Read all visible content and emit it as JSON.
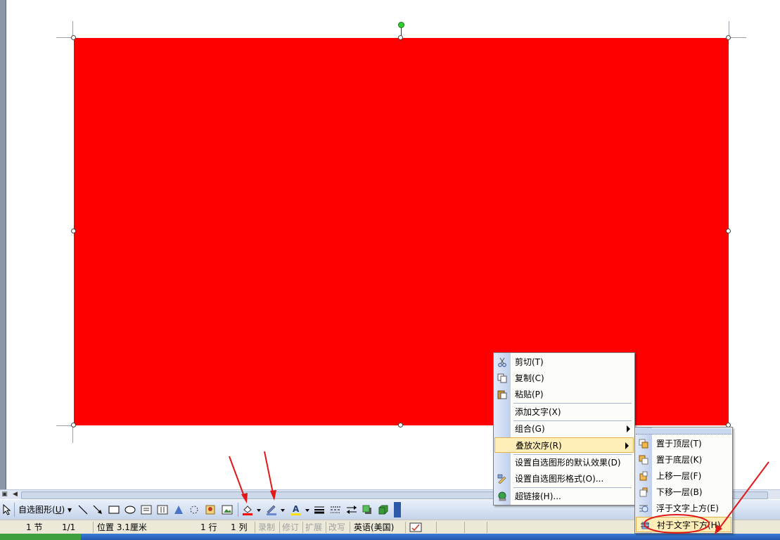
{
  "toolbar": {
    "autoshapes_label": "自选图形",
    "autoshapes_key": "U"
  },
  "statusbar": {
    "section": "1 节",
    "page": "1/1",
    "position": "位置 3.1厘米",
    "line": "1 行",
    "column": "1 列",
    "record": "录制",
    "revise": "修订",
    "extend": "扩展",
    "overwrite": "改写",
    "language": "英语(美国)"
  },
  "context_menu": {
    "cut": "剪切(T)",
    "copy": "复制(C)",
    "paste": "粘贴(P)",
    "add_text": "添加文字(X)",
    "group": "组合(G)",
    "order": "叠放次序(R)",
    "set_default": "设置自选图形的默认效果(D)",
    "format_autoshape": "设置自选图形格式(O)...",
    "hyperlink": "超链接(H)..."
  },
  "submenu": {
    "bring_to_front": "置于顶层(T)",
    "send_to_back": "置于底层(K)",
    "bring_forward": "上移一层(F)",
    "send_backward": "下移一层(B)",
    "in_front_of_text": "浮于文字上方(E)",
    "behind_text": "衬于文字下方(H)"
  },
  "colors": {
    "shape_fill": "#ff0000",
    "annotation": "#e01818",
    "menu_highlight": "#ffeeb8"
  }
}
